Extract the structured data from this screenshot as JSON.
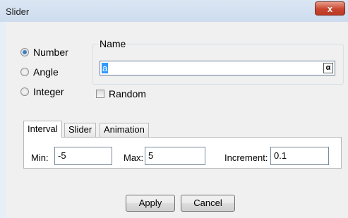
{
  "window": {
    "title": "Slider",
    "close_glyph": "x"
  },
  "type_options": [
    {
      "label": "Number",
      "checked": true
    },
    {
      "label": "Angle",
      "checked": false
    },
    {
      "label": "Integer",
      "checked": false
    }
  ],
  "name_group": {
    "legend": "Name",
    "value": "a",
    "symbol_button": "α"
  },
  "random": {
    "label": "Random",
    "checked": false
  },
  "tabs": [
    {
      "label": "Interval",
      "active": true
    },
    {
      "label": "Slider",
      "active": false
    },
    {
      "label": "Animation",
      "active": false
    }
  ],
  "interval": {
    "min_label": "Min:",
    "min_value": "-5",
    "max_label": "Max:",
    "max_value": "5",
    "increment_label": "Increment:",
    "increment_value": "0.1"
  },
  "buttons": {
    "apply": "Apply",
    "cancel": "Cancel"
  },
  "colors": {
    "selection": "#3399ff",
    "close_button": "#c94731",
    "dialog_bg": "#f0f0f0"
  }
}
